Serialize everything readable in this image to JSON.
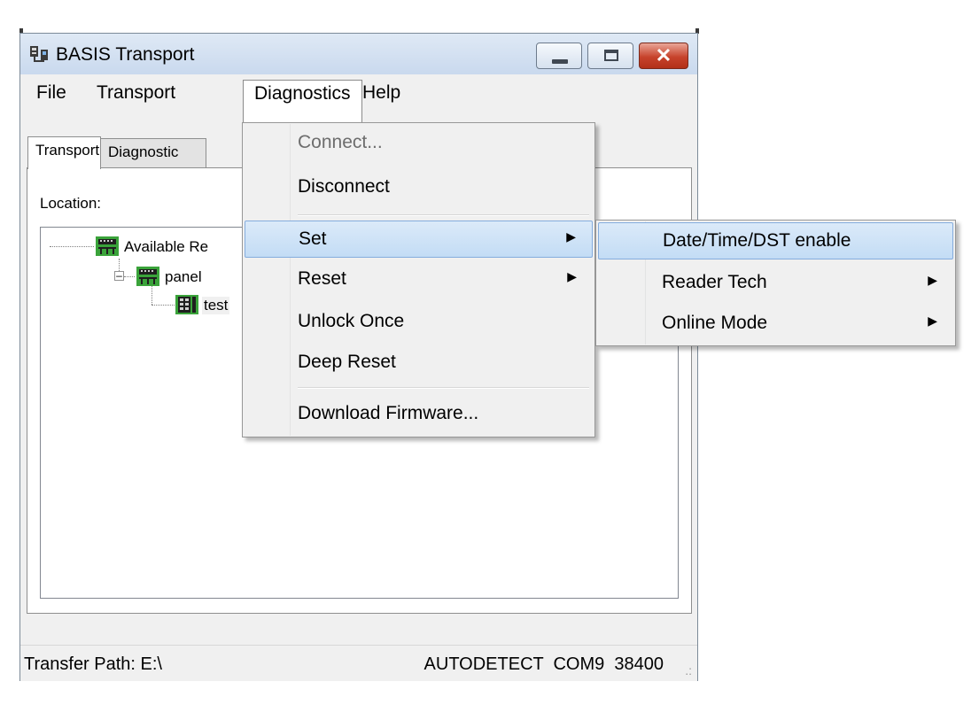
{
  "window": {
    "title": "BASIS Transport",
    "buttons": {
      "minimize": "minimize",
      "maximize": "maximize",
      "close": "✕"
    }
  },
  "menubar": {
    "items": [
      {
        "label": "File"
      },
      {
        "label": "Transport"
      },
      {
        "label": "Diagnostics",
        "open": true
      },
      {
        "label": "Help"
      }
    ]
  },
  "tabs": [
    {
      "label": "Transport",
      "active": true
    },
    {
      "label": "Diagnostic"
    }
  ],
  "panel": {
    "location_label": "Location:",
    "tree": [
      {
        "label": "Available Re",
        "icon": "network-panel-icon"
      },
      {
        "label": "panel",
        "icon": "network-panel-icon",
        "expander": "–"
      },
      {
        "label": "test",
        "icon": "reader-device-icon"
      }
    ]
  },
  "diagnostics_menu": {
    "items": [
      {
        "label": "Connect...",
        "disabled": true
      },
      {
        "label": "Disconnect"
      },
      {
        "label": "Set",
        "submenu": true,
        "highlighted": true
      },
      {
        "label": "Reset",
        "submenu": true
      },
      {
        "label": "Unlock Once"
      },
      {
        "label": "Deep Reset"
      },
      {
        "label": "Download Firmware..."
      }
    ],
    "arrow_glyph": "▶"
  },
  "set_submenu": {
    "items": [
      {
        "label": "Date/Time/DST enable",
        "highlighted": true
      },
      {
        "label": "Reader Tech",
        "submenu": true
      },
      {
        "label": "Online Mode",
        "submenu": true
      }
    ]
  },
  "statusbar": {
    "transfer_path": "Transfer Path: E:\\",
    "connection": "AUTODETECT  COM9  38400",
    "grip": ".:"
  },
  "colors": {
    "highlight": "#c3dcf5",
    "highlight_border": "#84acdd",
    "close_button": "#c7432c",
    "titlebar": "#c9d9ee",
    "icon_green": "#3aa33a"
  }
}
